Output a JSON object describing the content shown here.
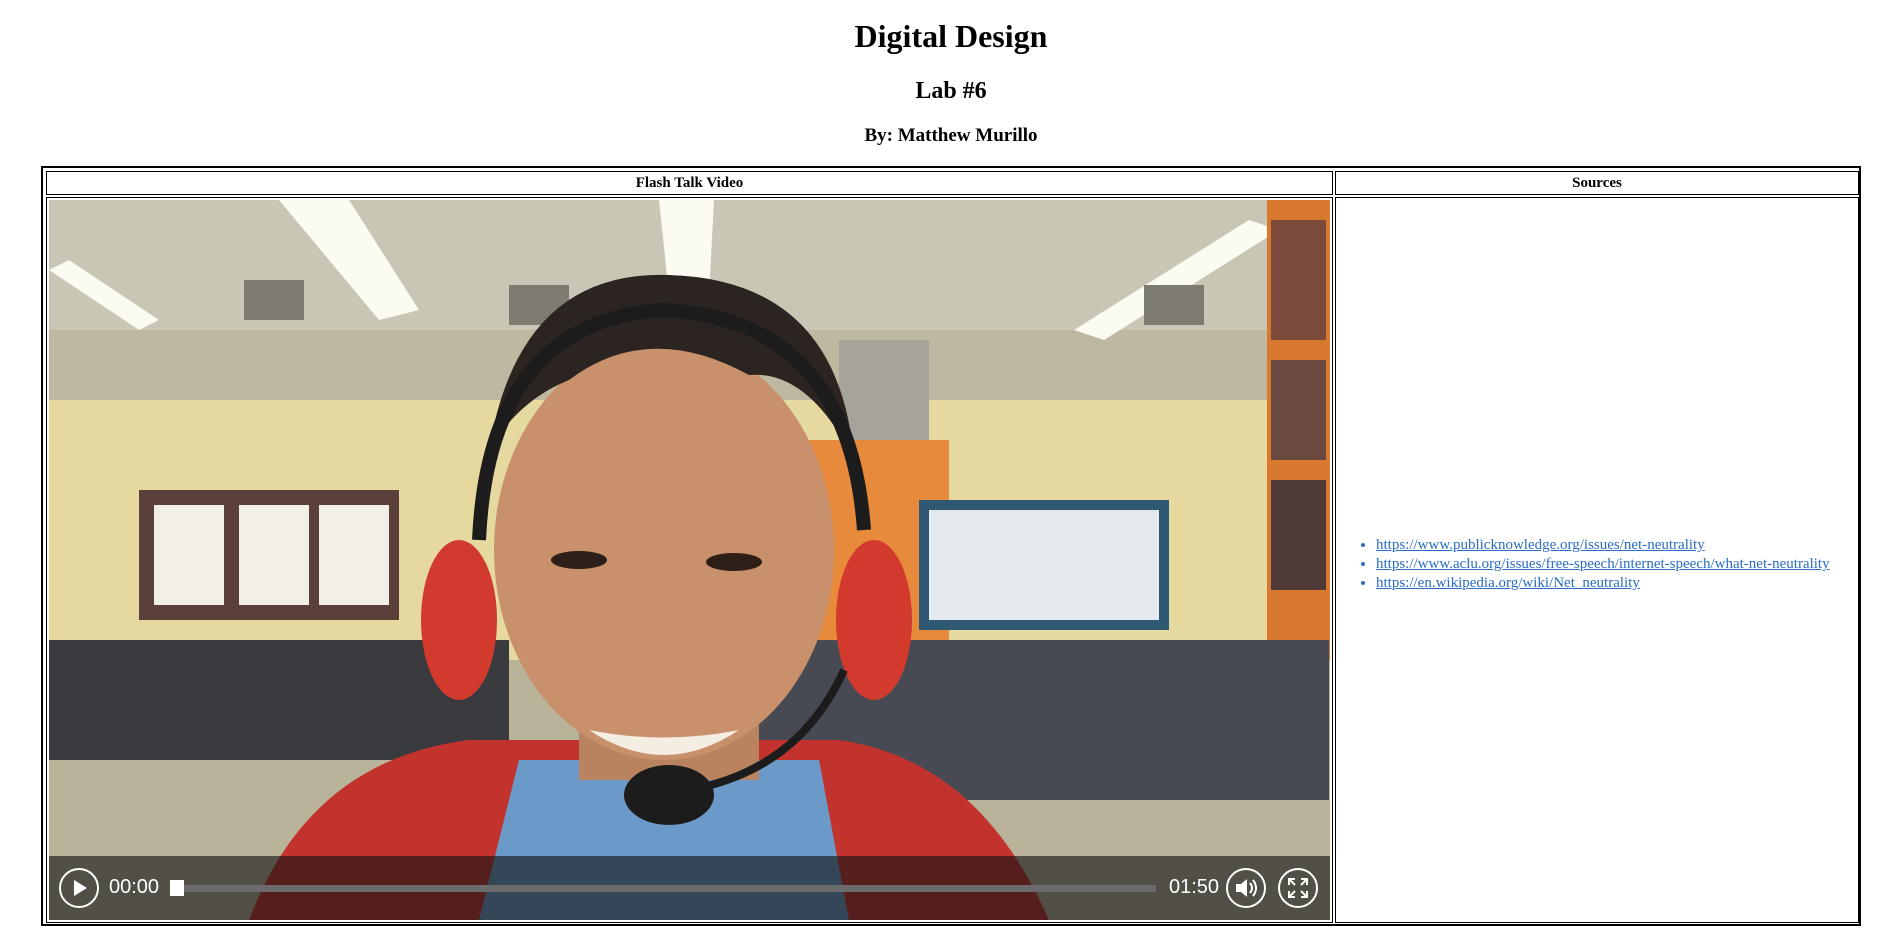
{
  "page": {
    "title": "Digital Design",
    "subtitle": "Lab #6",
    "author": "By: Matthew Murillo"
  },
  "table": {
    "video_header": "Flash Talk Video",
    "sources_header": "Sources"
  },
  "video": {
    "current_time": "00:00",
    "duration": "01:50",
    "progress": 0,
    "play_icon": "play-icon",
    "volume_icon": "volume-icon",
    "fullscreen_icon": "fullscreen-icon"
  },
  "sources": [
    "https://www.publicknowledge.org/issues/net-neutrality",
    "https://www.aclu.org/issues/free-speech/internet-speech/what-net-neutrality",
    "https://en.wikipedia.org/wiki/Net_neutrality"
  ],
  "colors": {
    "link": "#2b6cc4",
    "controls_bg": "#141414"
  }
}
